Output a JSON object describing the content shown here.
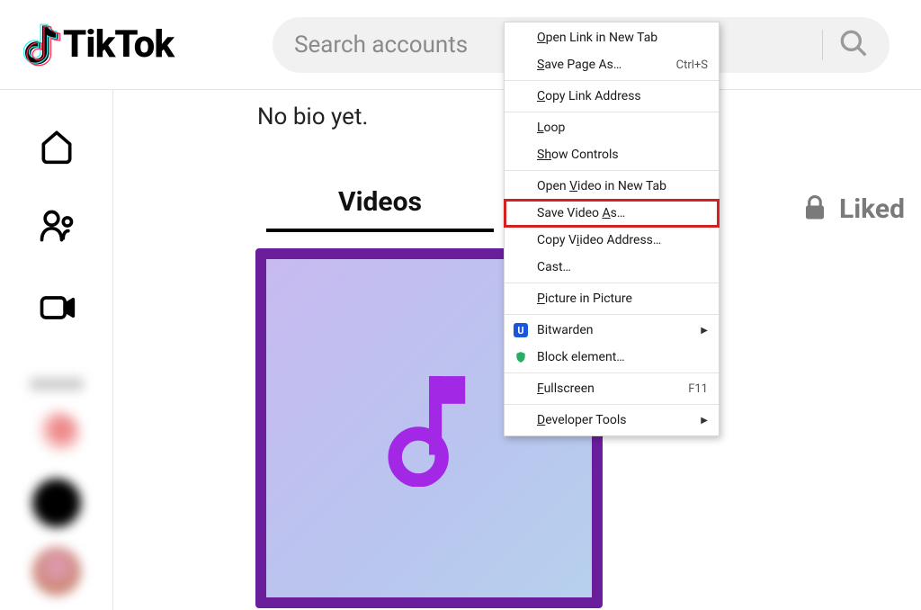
{
  "header": {
    "brand": "TikTok",
    "search_placeholder": "Search accounts"
  },
  "profile": {
    "bio": "No bio yet."
  },
  "tabs": {
    "videos": "Videos",
    "liked": "Liked"
  },
  "context_menu": {
    "open_link": "pen Link in New Tab",
    "open_link_u": "O",
    "save_page": "ave Page As…",
    "save_page_u": "S",
    "save_page_shortcut": "Ctrl+S",
    "copy_link": "opy Link Address",
    "copy_link_u": "C",
    "loop": "oop",
    "loop_u": "L",
    "show_controls": "ow Controls",
    "show_controls_u": "Sh",
    "open_video": "ideo in New Tab",
    "open_video_pre": "Open ",
    "open_video_u": "V",
    "save_video": "s…",
    "save_video_pre": "Save Video ",
    "save_video_u": "A",
    "copy_video_addr": "ideo Address…",
    "copy_video_addr_pre": "Copy V",
    "copy_video_addr_u": "i",
    "cast": "t…",
    "cast_pre": "Cas",
    "cast_u": "",
    "pip": "icture in Picture",
    "pip_u": "P",
    "bitwarden": "Bitwarden",
    "block_element": "Block element…",
    "fullscreen": "ullscreen",
    "fullscreen_u": "F",
    "fullscreen_shortcut": "F11",
    "dev_tools": "eveloper Tools",
    "dev_tools_u": "D"
  }
}
